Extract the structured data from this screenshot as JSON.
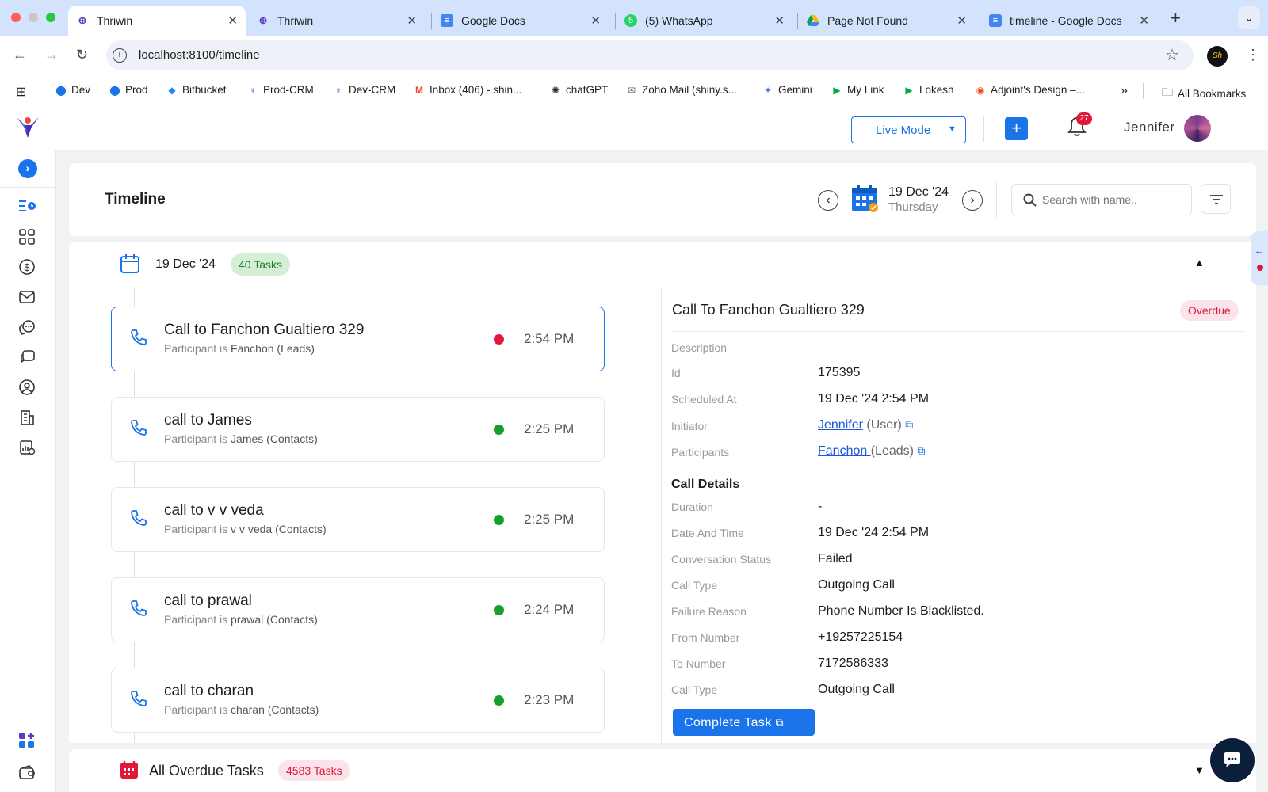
{
  "browser": {
    "tabs": [
      {
        "label": "Thriwin",
        "icon": "thriwin-logo-icon",
        "active": true
      },
      {
        "label": "Thriwin",
        "icon": "thriwin-logo-icon",
        "active": false
      },
      {
        "label": "Google Docs",
        "icon": "google-docs-icon",
        "active": false
      },
      {
        "label": "(5) WhatsApp",
        "icon": "whatsapp-icon",
        "active": false
      },
      {
        "label": "Page Not Found",
        "icon": "google-drive-icon",
        "active": false
      },
      {
        "label": "timeline - Google Docs",
        "icon": "google-docs-icon",
        "active": false
      }
    ],
    "url": "localhost:8100/timeline",
    "bookmarks": [
      "Dev",
      "Prod",
      "Bitbucket",
      "Prod-CRM",
      "Dev-CRM",
      "Inbox (406) - shin...",
      "chatGPT",
      "Zoho Mail (shiny.s...",
      "Gemini",
      "My Link",
      "Lokesh",
      "Adjoint's Design –...",
      "All Bookmarks"
    ],
    "overflow_label": "»"
  },
  "header": {
    "mode_label": "Live Mode",
    "notification_count": "27",
    "user_name": "Jennifer"
  },
  "timeline": {
    "title": "Timeline",
    "date_main": "19 Dec '24",
    "date_day": "Thursday",
    "search_placeholder": "Search with name.."
  },
  "day_group": {
    "date": "19 Dec '24",
    "count_label": "40 Tasks"
  },
  "tasks": [
    {
      "title": "Call to Fanchon Gualtiero 329",
      "prefix": "Participant is",
      "participant": "Fanchon (Leads)",
      "time": "2:54 PM",
      "status_color": "#e0193a"
    },
    {
      "title": "call to James",
      "prefix": "Participant is",
      "participant": "James (Contacts)",
      "time": "2:25 PM",
      "status_color": "#12a12d"
    },
    {
      "title": "call to v v veda",
      "prefix": "Participant is",
      "participant": "v v veda (Contacts)",
      "time": "2:25 PM",
      "status_color": "#12a12d"
    },
    {
      "title": "call to prawal",
      "prefix": "Participant is",
      "participant": "prawal (Contacts)",
      "time": "2:24 PM",
      "status_color": "#12a12d"
    },
    {
      "title": "call to charan",
      "prefix": "Participant is",
      "participant": "charan (Contacts)",
      "time": "2:23 PM",
      "status_color": "#12a12d"
    }
  ],
  "detail": {
    "title": "Call To Fanchon Gualtiero 329",
    "badge": "Overdue",
    "labels": {
      "description": "Description",
      "id": "Id",
      "scheduled_at": "Scheduled At",
      "initiator": "Initiator",
      "participants": "Participants"
    },
    "id": "175395",
    "scheduled_at": "19 Dec '24 2:54 PM",
    "initiator_name": "Jennifer",
    "initiator_type": "(User)",
    "participant_name": "Fanchon ",
    "participant_type": "(Leads)",
    "call_details_heading": "Call Details",
    "call_details": [
      {
        "label": "Duration",
        "value": "-"
      },
      {
        "label": "Date And Time",
        "value": "19 Dec '24 2:54 PM"
      },
      {
        "label": "Conversation Status",
        "value": "Failed"
      },
      {
        "label": "Call Type",
        "value": "Outgoing Call"
      },
      {
        "label": "Failure Reason",
        "value": "Phone Number Is Blacklisted."
      },
      {
        "label": "From Number",
        "value": "+19257225154"
      },
      {
        "label": "To Number",
        "value": "7172586333"
      },
      {
        "label": "Call Type",
        "value": "Outgoing Call"
      }
    ],
    "complete_button": "Complete Task"
  },
  "overdue": {
    "label": "All Overdue Tasks",
    "count_label": "4583 Tasks"
  },
  "colors": {
    "accent": "#1a73e8",
    "overdue_badge_bg": "#fbe3ea",
    "overdue_badge_text": "#e0193a",
    "tasks_badge_bg": "#d5efd7",
    "tasks_badge_text": "#1f7a2a"
  }
}
